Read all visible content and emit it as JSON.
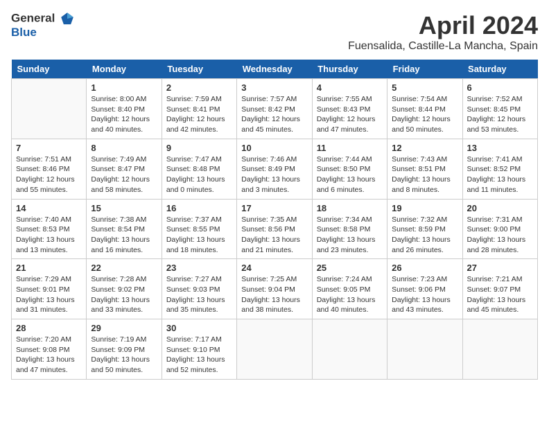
{
  "header": {
    "logo_line1": "General",
    "logo_line2": "Blue",
    "month_title": "April 2024",
    "location": "Fuensalida, Castille-La Mancha, Spain"
  },
  "days_of_week": [
    "Sunday",
    "Monday",
    "Tuesday",
    "Wednesday",
    "Thursday",
    "Friday",
    "Saturday"
  ],
  "weeks": [
    [
      {
        "day": "",
        "sunrise": "",
        "sunset": "",
        "daylight": ""
      },
      {
        "day": "1",
        "sunrise": "Sunrise: 8:00 AM",
        "sunset": "Sunset: 8:40 PM",
        "daylight": "Daylight: 12 hours and 40 minutes."
      },
      {
        "day": "2",
        "sunrise": "Sunrise: 7:59 AM",
        "sunset": "Sunset: 8:41 PM",
        "daylight": "Daylight: 12 hours and 42 minutes."
      },
      {
        "day": "3",
        "sunrise": "Sunrise: 7:57 AM",
        "sunset": "Sunset: 8:42 PM",
        "daylight": "Daylight: 12 hours and 45 minutes."
      },
      {
        "day": "4",
        "sunrise": "Sunrise: 7:55 AM",
        "sunset": "Sunset: 8:43 PM",
        "daylight": "Daylight: 12 hours and 47 minutes."
      },
      {
        "day": "5",
        "sunrise": "Sunrise: 7:54 AM",
        "sunset": "Sunset: 8:44 PM",
        "daylight": "Daylight: 12 hours and 50 minutes."
      },
      {
        "day": "6",
        "sunrise": "Sunrise: 7:52 AM",
        "sunset": "Sunset: 8:45 PM",
        "daylight": "Daylight: 12 hours and 53 minutes."
      }
    ],
    [
      {
        "day": "7",
        "sunrise": "Sunrise: 7:51 AM",
        "sunset": "Sunset: 8:46 PM",
        "daylight": "Daylight: 12 hours and 55 minutes."
      },
      {
        "day": "8",
        "sunrise": "Sunrise: 7:49 AM",
        "sunset": "Sunset: 8:47 PM",
        "daylight": "Daylight: 12 hours and 58 minutes."
      },
      {
        "day": "9",
        "sunrise": "Sunrise: 7:47 AM",
        "sunset": "Sunset: 8:48 PM",
        "daylight": "Daylight: 13 hours and 0 minutes."
      },
      {
        "day": "10",
        "sunrise": "Sunrise: 7:46 AM",
        "sunset": "Sunset: 8:49 PM",
        "daylight": "Daylight: 13 hours and 3 minutes."
      },
      {
        "day": "11",
        "sunrise": "Sunrise: 7:44 AM",
        "sunset": "Sunset: 8:50 PM",
        "daylight": "Daylight: 13 hours and 6 minutes."
      },
      {
        "day": "12",
        "sunrise": "Sunrise: 7:43 AM",
        "sunset": "Sunset: 8:51 PM",
        "daylight": "Daylight: 13 hours and 8 minutes."
      },
      {
        "day": "13",
        "sunrise": "Sunrise: 7:41 AM",
        "sunset": "Sunset: 8:52 PM",
        "daylight": "Daylight: 13 hours and 11 minutes."
      }
    ],
    [
      {
        "day": "14",
        "sunrise": "Sunrise: 7:40 AM",
        "sunset": "Sunset: 8:53 PM",
        "daylight": "Daylight: 13 hours and 13 minutes."
      },
      {
        "day": "15",
        "sunrise": "Sunrise: 7:38 AM",
        "sunset": "Sunset: 8:54 PM",
        "daylight": "Daylight: 13 hours and 16 minutes."
      },
      {
        "day": "16",
        "sunrise": "Sunrise: 7:37 AM",
        "sunset": "Sunset: 8:55 PM",
        "daylight": "Daylight: 13 hours and 18 minutes."
      },
      {
        "day": "17",
        "sunrise": "Sunrise: 7:35 AM",
        "sunset": "Sunset: 8:56 PM",
        "daylight": "Daylight: 13 hours and 21 minutes."
      },
      {
        "day": "18",
        "sunrise": "Sunrise: 7:34 AM",
        "sunset": "Sunset: 8:58 PM",
        "daylight": "Daylight: 13 hours and 23 minutes."
      },
      {
        "day": "19",
        "sunrise": "Sunrise: 7:32 AM",
        "sunset": "Sunset: 8:59 PM",
        "daylight": "Daylight: 13 hours and 26 minutes."
      },
      {
        "day": "20",
        "sunrise": "Sunrise: 7:31 AM",
        "sunset": "Sunset: 9:00 PM",
        "daylight": "Daylight: 13 hours and 28 minutes."
      }
    ],
    [
      {
        "day": "21",
        "sunrise": "Sunrise: 7:29 AM",
        "sunset": "Sunset: 9:01 PM",
        "daylight": "Daylight: 13 hours and 31 minutes."
      },
      {
        "day": "22",
        "sunrise": "Sunrise: 7:28 AM",
        "sunset": "Sunset: 9:02 PM",
        "daylight": "Daylight: 13 hours and 33 minutes."
      },
      {
        "day": "23",
        "sunrise": "Sunrise: 7:27 AM",
        "sunset": "Sunset: 9:03 PM",
        "daylight": "Daylight: 13 hours and 35 minutes."
      },
      {
        "day": "24",
        "sunrise": "Sunrise: 7:25 AM",
        "sunset": "Sunset: 9:04 PM",
        "daylight": "Daylight: 13 hours and 38 minutes."
      },
      {
        "day": "25",
        "sunrise": "Sunrise: 7:24 AM",
        "sunset": "Sunset: 9:05 PM",
        "daylight": "Daylight: 13 hours and 40 minutes."
      },
      {
        "day": "26",
        "sunrise": "Sunrise: 7:23 AM",
        "sunset": "Sunset: 9:06 PM",
        "daylight": "Daylight: 13 hours and 43 minutes."
      },
      {
        "day": "27",
        "sunrise": "Sunrise: 7:21 AM",
        "sunset": "Sunset: 9:07 PM",
        "daylight": "Daylight: 13 hours and 45 minutes."
      }
    ],
    [
      {
        "day": "28",
        "sunrise": "Sunrise: 7:20 AM",
        "sunset": "Sunset: 9:08 PM",
        "daylight": "Daylight: 13 hours and 47 minutes."
      },
      {
        "day": "29",
        "sunrise": "Sunrise: 7:19 AM",
        "sunset": "Sunset: 9:09 PM",
        "daylight": "Daylight: 13 hours and 50 minutes."
      },
      {
        "day": "30",
        "sunrise": "Sunrise: 7:17 AM",
        "sunset": "Sunset: 9:10 PM",
        "daylight": "Daylight: 13 hours and 52 minutes."
      },
      {
        "day": "",
        "sunrise": "",
        "sunset": "",
        "daylight": ""
      },
      {
        "day": "",
        "sunrise": "",
        "sunset": "",
        "daylight": ""
      },
      {
        "day": "",
        "sunrise": "",
        "sunset": "",
        "daylight": ""
      },
      {
        "day": "",
        "sunrise": "",
        "sunset": "",
        "daylight": ""
      }
    ]
  ]
}
